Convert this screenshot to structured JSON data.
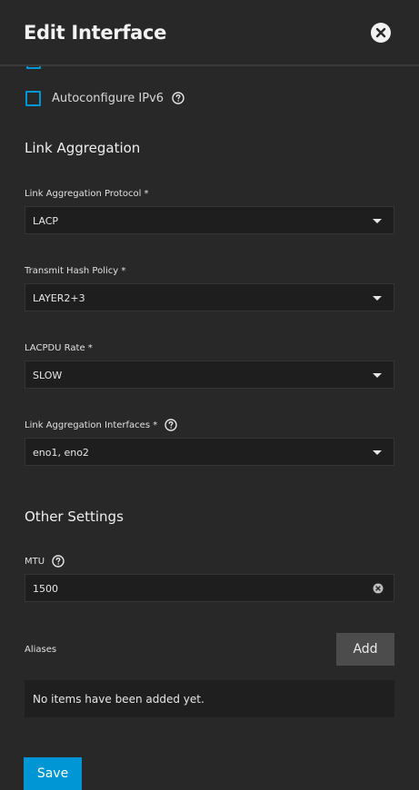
{
  "header": {
    "title": "Edit Interface"
  },
  "ipv6": {
    "label": "Autoconfigure IPv6",
    "checked": false
  },
  "link_aggregation": {
    "section_title": "Link Aggregation",
    "protocol": {
      "label": "Link Aggregation Protocol *",
      "value": "LACP"
    },
    "hash_policy": {
      "label": "Transmit Hash Policy *",
      "value": "LAYER2+3"
    },
    "lacpdu_rate": {
      "label": "LACPDU Rate *",
      "value": "SLOW"
    },
    "interfaces": {
      "label": "Link Aggregation Interfaces *",
      "value": "eno1, eno2"
    }
  },
  "other_settings": {
    "section_title": "Other Settings",
    "mtu": {
      "label": "MTU",
      "value": "1500"
    }
  },
  "aliases": {
    "label": "Aliases",
    "add_label": "Add",
    "empty_message": "No items have been added yet."
  },
  "footer": {
    "save_label": "Save"
  },
  "colors": {
    "accent": "#0095d5",
    "background": "#282828",
    "field_bg": "#1e1e1e"
  }
}
